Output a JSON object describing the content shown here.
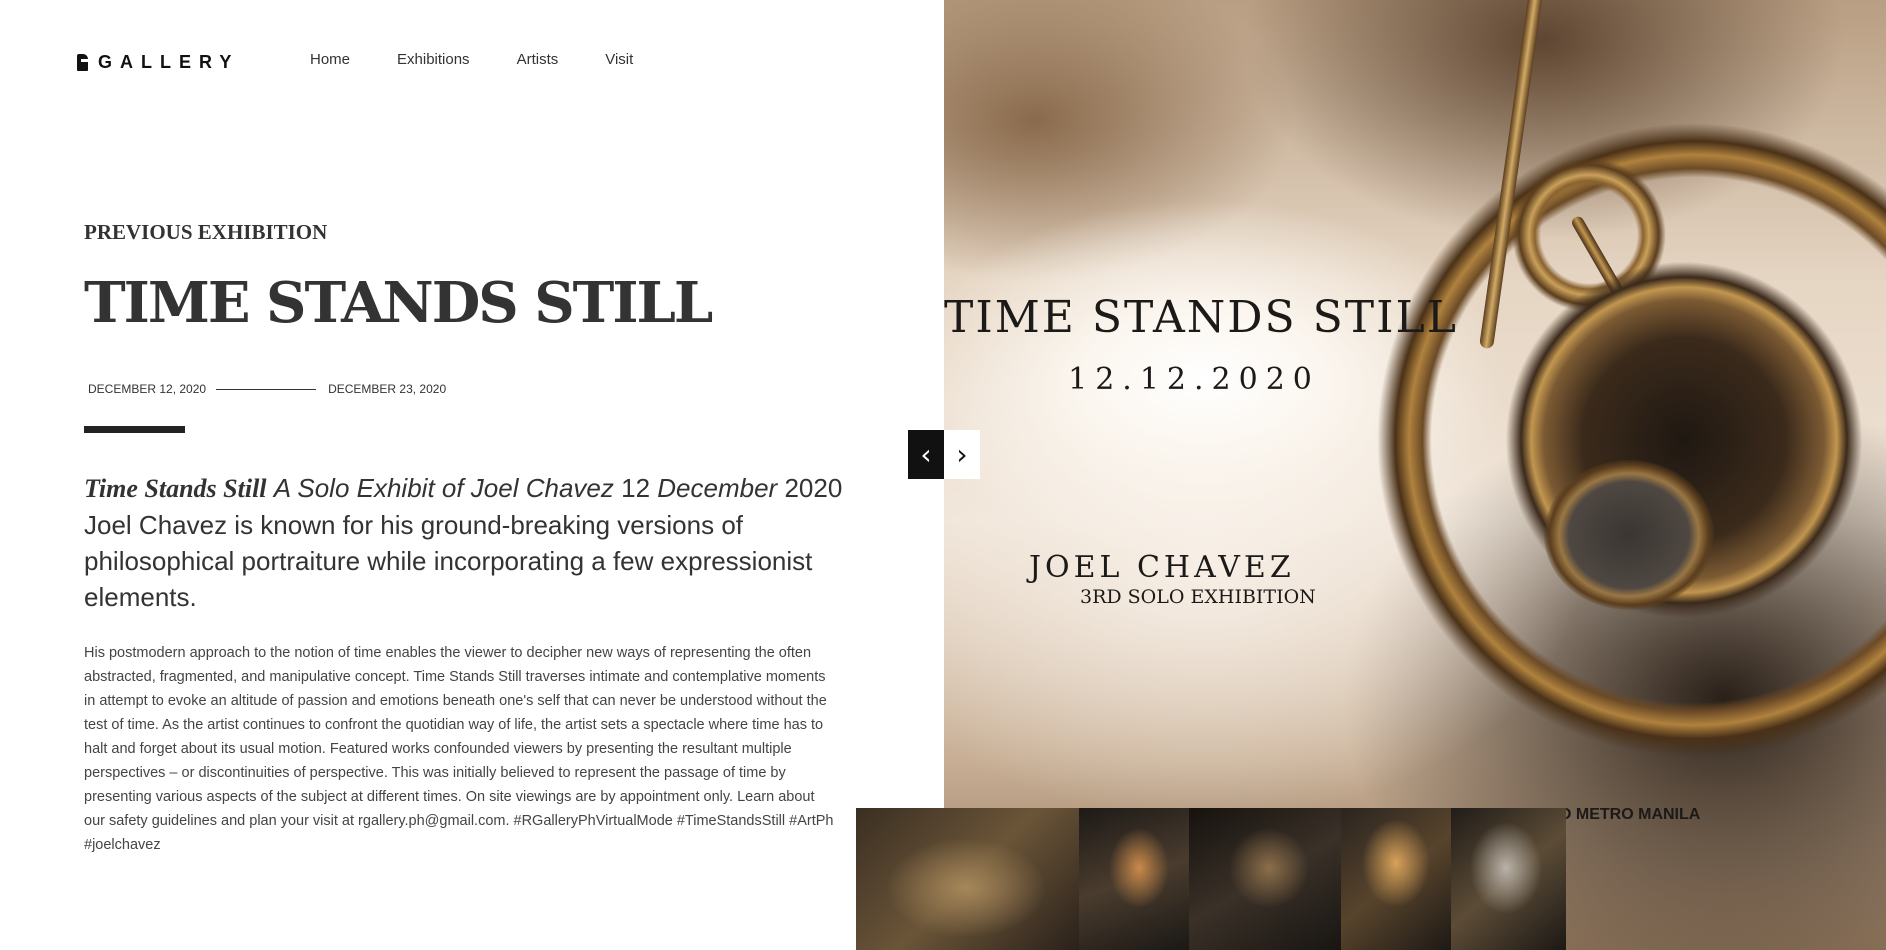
{
  "header": {
    "logo_text": "GALLERY",
    "nav": [
      "Home",
      "Exhibitions",
      "Artists",
      "Visit"
    ]
  },
  "exhibition": {
    "eyebrow": "PREVIOUS EXHIBITION",
    "title": "TIME STANDS STILL",
    "start_date": "DECEMBER 12, 2020",
    "end_date": "DECEMBER 23, 2020",
    "lead": {
      "title_italic": "Time Stands Still",
      "subtitle_italic": "A Solo Exhibit of Joel Chavez",
      "day": "12",
      "month_italic": "December",
      "year": "2020",
      "text": "Joel Chavez is known for his ground-breaking versions of philosophical portraiture while incorporating a few expressionist elements."
    },
    "body": "His postmodern approach to the notion of time enables the viewer to decipher new ways of representing the often abstracted, fragmented, and manipulative concept. Time Stands Still traverses intimate and contemplative moments in attempt to evoke an altitude of passion and emotions beneath one's self that can never be understood without the test of time. As the artist continues to confront the quotidian way of life, the artist sets a spectacle where time has to halt and forget about its usual motion. Featured works confounded viewers by presenting the resultant multiple perspectives – or discontinuities of perspective. This was initially believed to represent the passage of time by presenting various aspects of the subject at different times. On site viewings are by appointment only. Learn about our safety guidelines and plan your visit at rgallery.ph@gmail.com. #RGalleryPhVirtualMode #TimeStandsStill #ArtPh #joelchavez"
  },
  "poster": {
    "title": "TIME STANDS STILL",
    "date": "12.12.2020",
    "artist": "JOEL CHAVEZ",
    "subtitle": "3RD SOLO EXHIBITION",
    "location": "O METRO MANILA"
  },
  "slider": {
    "prev_icon": "‹",
    "next_icon": "›",
    "thumbnail_count": 5
  }
}
